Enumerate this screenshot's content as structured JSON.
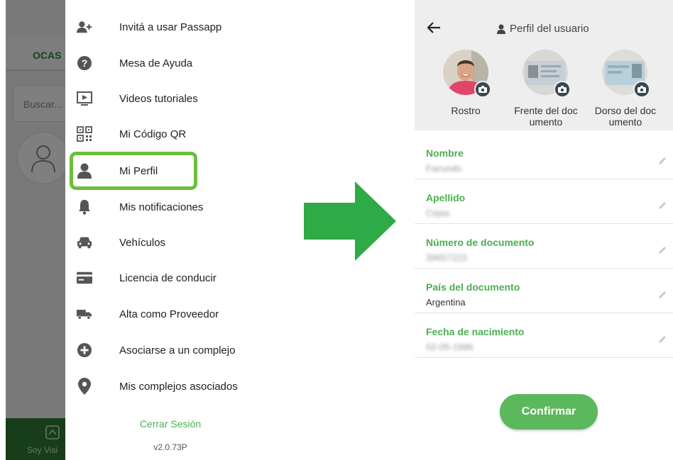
{
  "left_screen": {
    "background": {
      "tab_label": "OCAS",
      "search_placeholder": "Buscar...",
      "bottom_nav_label": "Soy Visi"
    },
    "drawer": {
      "items": [
        {
          "label": "Invitá a usar Passapp",
          "icon": "add-user-icon"
        },
        {
          "label": "Mesa de Ayuda",
          "icon": "help-icon"
        },
        {
          "label": "Videos tutoriales",
          "icon": "video-icon"
        },
        {
          "label": "Mi Código QR",
          "icon": "qr-code-icon"
        },
        {
          "label": "Mi Perfil",
          "icon": "person-icon"
        },
        {
          "label": "Mis notificaciones",
          "icon": "bell-icon"
        },
        {
          "label": "Vehículos",
          "icon": "car-icon"
        },
        {
          "label": "Licencia de conducir",
          "icon": "card-icon"
        },
        {
          "label": "Alta como Proveedor",
          "icon": "truck-icon"
        },
        {
          "label": "Asociarse a un complejo",
          "icon": "plus-circle-icon"
        },
        {
          "label": "Mis complejos asociados",
          "icon": "location-pin-icon"
        }
      ],
      "logout_label": "Cerrar Sesión",
      "version": "v2.0.73P"
    },
    "highlight_color": "#6abf3b"
  },
  "arrow_color": "#2eaa46",
  "right_screen": {
    "title": "Perfil del usuario",
    "photos": [
      {
        "label": "Rostro"
      },
      {
        "label": "Frente del documento"
      },
      {
        "label": "Dorso del documento"
      }
    ],
    "fields": [
      {
        "label": "Nombre",
        "value": "Facundo"
      },
      {
        "label": "Apellido",
        "value": "Cejas"
      },
      {
        "label": "Número de documento",
        "value": "39657223"
      },
      {
        "label": "País del documento",
        "value": "Argentina"
      },
      {
        "label": "Fecha de nacimiento",
        "value": "02-05-1996"
      }
    ],
    "confirm_label": "Confirmar",
    "accent_color": "#4caf50"
  }
}
